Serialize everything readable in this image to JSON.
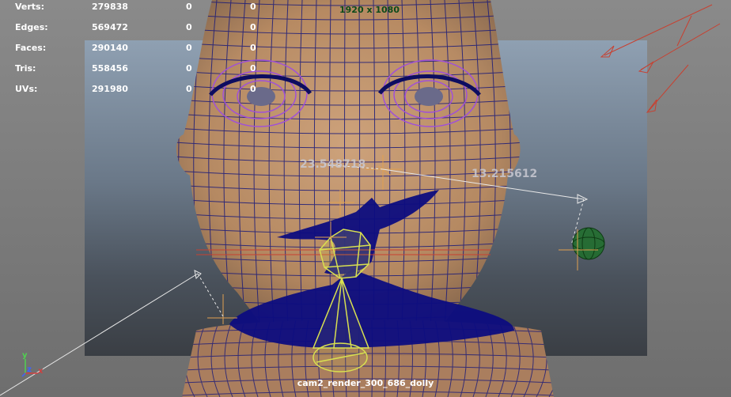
{
  "stats": {
    "rows": [
      {
        "label": "Verts:",
        "value": "279838",
        "selected": "0",
        "components": "0"
      },
      {
        "label": "Edges:",
        "value": "569472",
        "selected": "0",
        "components": "0"
      },
      {
        "label": "Faces:",
        "value": "290140",
        "selected": "0",
        "components": "0"
      },
      {
        "label": "Tris:",
        "value": "558456",
        "selected": "0",
        "components": "0"
      },
      {
        "label": "UVs:",
        "value": "291980",
        "selected": "0",
        "components": "0"
      }
    ]
  },
  "resolution": "1920 x 1080",
  "camera": "cam2_render_300_686_dolly",
  "measurements": {
    "distance_a": "23.548718",
    "distance_b": "13.215612"
  },
  "axis_gizmo": {
    "y_label": "y",
    "z_label": "z",
    "x_label": "x"
  },
  "colors": {
    "wireframe": "#1a1a7a",
    "skin": "#c99a6e",
    "dark_mesh": "#0d0d80",
    "selected_cage": "#d8e050",
    "eye_cage": "#a050d8",
    "locator_green": "#1e6e2a",
    "guide_red": "#c84030"
  }
}
